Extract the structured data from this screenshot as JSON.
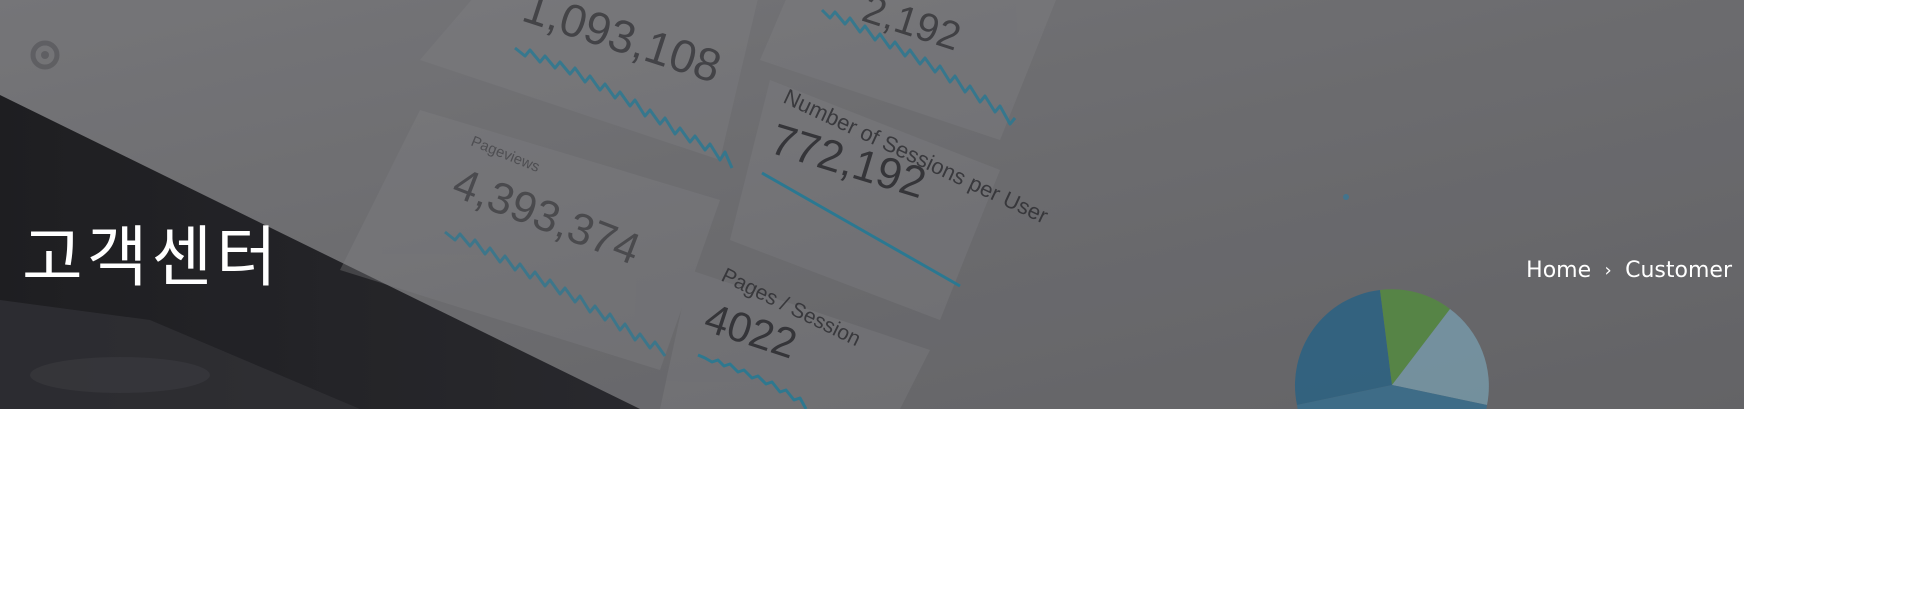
{
  "header": {
    "page_title": "고객센터",
    "breadcrumb": {
      "home_label": "Home",
      "separator_icon": "chevron-right-icon",
      "current_label": "Customer"
    }
  },
  "background_image": {
    "texts": {
      "stat_top_left": "1,093,108",
      "stat_top_right": "2,192",
      "label_pageviews": "Pageviews",
      "stat_pageviews": "4,393,374",
      "label_sessions_per_user": "Number of Sessions per User",
      "stat_sessions_per_user": "772,192",
      "label_pages_session": "Pages / Session",
      "stat_pages_session": "4022"
    },
    "colors": {
      "line_accent": "#1a8fb3",
      "pie_blue": "#1f6f9c",
      "pie_green": "#5aa83c",
      "pie_light": "#8fc6dc"
    }
  }
}
